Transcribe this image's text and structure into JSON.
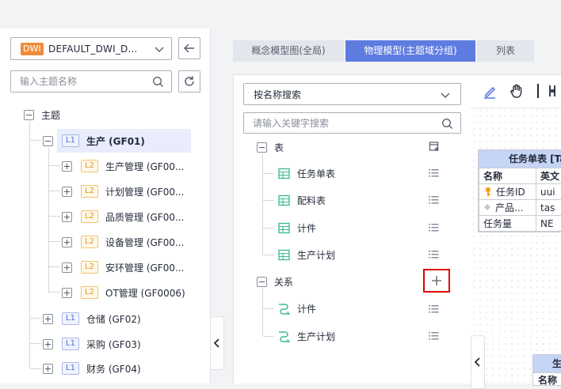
{
  "left": {
    "workspace": {
      "badge": "DWI",
      "name": "DEFAULT_DWI_D..."
    },
    "search_placeholder": "输入主题名称",
    "tree": {
      "root": "主题",
      "l1_items": [
        {
          "level": "L1",
          "label": "生产 (GF01)"
        },
        {
          "level": "L1",
          "label": "仓储 (GF02)"
        },
        {
          "level": "L1",
          "label": "采购 (GF03)"
        },
        {
          "level": "L1",
          "label": "财务 (GF04)"
        }
      ],
      "l2_items": [
        {
          "level": "L2",
          "label": "生产管理 (GF00..."
        },
        {
          "level": "L2",
          "label": "计划管理 (GF00..."
        },
        {
          "level": "L2",
          "label": "品质管理 (GF00..."
        },
        {
          "level": "L2",
          "label": "设备管理 (GF00..."
        },
        {
          "level": "L2",
          "label": "安环管理 (GF00..."
        },
        {
          "level": "L2",
          "label": "OT管理 (GF0006)"
        }
      ]
    }
  },
  "tabs": [
    {
      "label": "概念模型图(全局)"
    },
    {
      "label": "物理模型(主题域分组)"
    },
    {
      "label": "列表"
    }
  ],
  "middle": {
    "search_mode": "按名称搜索",
    "keyword_placeholder": "请输入关键字搜索",
    "tables_group": "表",
    "tables": [
      "任务单表",
      "配料表",
      "计件",
      "生产计划"
    ],
    "relations_group": "关系",
    "relations": [
      "计件",
      "生产计划"
    ]
  },
  "canvas": {
    "entity_title": "任务单表 [Ta",
    "header_name": "名称",
    "header_en": "英文",
    "rows": [
      {
        "name": "任务ID",
        "en": "uui"
      },
      {
        "name": "产品...",
        "en": "tas"
      },
      {
        "name": "任务量",
        "en": "NE"
      }
    ],
    "entity2_title": "生",
    "entity2_header": "名称"
  },
  "colors": {
    "accent": "#5e7ce0",
    "highlight": "#e00000",
    "table_icon": "#3bb88f"
  }
}
